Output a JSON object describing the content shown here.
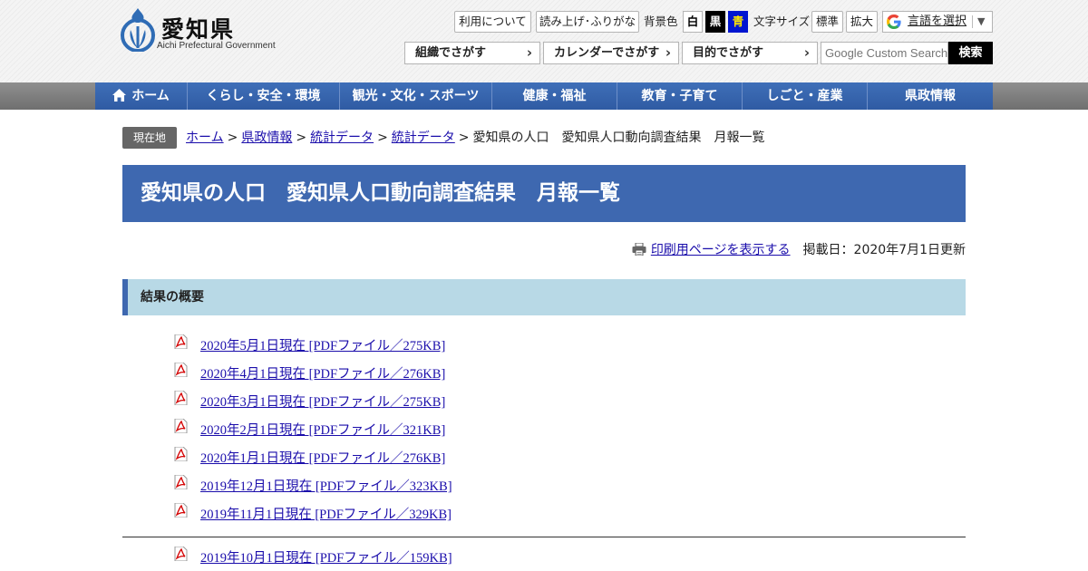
{
  "header": {
    "logo_name": "愛知県",
    "logo_en": "Aichi Prefectural Government",
    "usage_label": "利用について",
    "reader_label": "読み上げ･ふりがな",
    "bgcolor_label": "背景色",
    "bg_white": "白",
    "bg_black": "黒",
    "bg_blue": "青",
    "fontsize_label": "文字サイズ",
    "font_standard": "標準",
    "font_large": "拡大",
    "translate_label": "言語を選択",
    "translate_caret": "▼",
    "find_buttons": [
      "組織でさがす",
      "カレンダーでさがす",
      "目的でさがす"
    ],
    "search_placeholder": "Google Custom Search",
    "search_button": "検索"
  },
  "nav": {
    "items": [
      "ホーム",
      "くらし・安全・環境",
      "観光・文化・スポーツ",
      "健康・福祉",
      "教育・子育て",
      "しごと・産業",
      "県政情報"
    ]
  },
  "breadcrumb": {
    "label": "現在地",
    "links": [
      "ホーム",
      "県政情報",
      "統計データ",
      "統計データ"
    ],
    "current": "愛知県の人口　愛知県人口動向調査結果　月報一覧"
  },
  "page": {
    "title": "愛知県の人口　愛知県人口動向調査結果　月報一覧",
    "print_link": "印刷用ページを表示する",
    "posted": "掲載日：2020年7月1日更新",
    "section_title": "結果の概要"
  },
  "files": [
    "2020年5月1日現在 [PDFファイル／275KB]",
    "2020年4月1日現在 [PDFファイル／276KB]",
    "2020年3月1日現在 [PDFファイル／275KB]",
    "2020年2月1日現在 [PDFファイル／321KB]",
    "2020年1月1日現在 [PDFファイル／276KB]",
    "2019年12月1日現在 [PDFファイル／323KB]",
    "2019年11月1日現在 [PDFファイル／329KB]"
  ],
  "files_2": [
    "2019年10月1日現在 [PDFファイル／159KB]"
  ],
  "colors": {
    "brand_blue": "#3e68b0",
    "section_bg": "#b8d9e6",
    "link": "#1a0dab"
  }
}
